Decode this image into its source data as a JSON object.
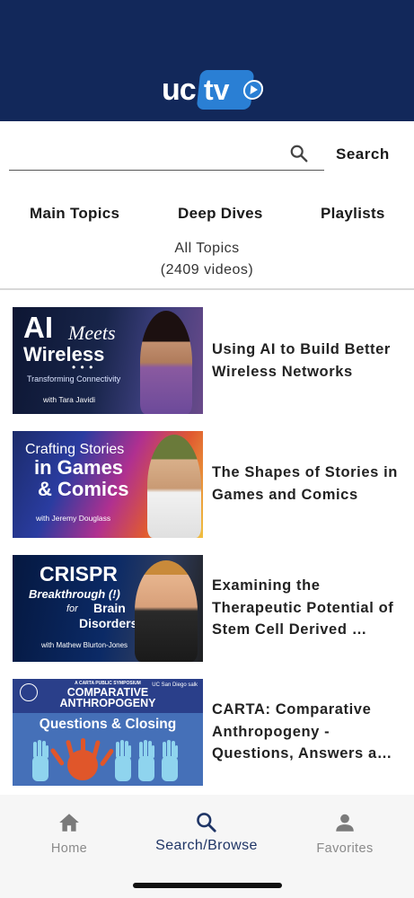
{
  "app": {
    "logo_text_left": "uc",
    "logo_text_right": "tv"
  },
  "search": {
    "placeholder": "",
    "value": "",
    "button_label": "Search",
    "icon": "search-icon"
  },
  "tabs": [
    {
      "label": "Main Topics"
    },
    {
      "label": "Deep Dives"
    },
    {
      "label": "Playlists"
    }
  ],
  "topic": {
    "title": "All Topics",
    "count": "(2409 videos)"
  },
  "videos": [
    {
      "title": "Using AI to Build Better Wireless Networks",
      "thumb": {
        "line1": "AI",
        "line2": "Meets",
        "line3": "Wireless",
        "dots": "• • •",
        "sub": "Transforming Connectivity",
        "with": "with Tara Javidi"
      }
    },
    {
      "title": "The Shapes of Stories in Games and Comics",
      "thumb": {
        "line1": "Crafting Stories",
        "line2": "in Games",
        "line3": "& Comics",
        "with": "with Jeremy Douglass"
      }
    },
    {
      "title": "Examining the Therapeutic Potential of Stem Cell Derived …",
      "thumb": {
        "line1": "CRISPR",
        "line2": "Breakthrough (!)",
        "line3": "for",
        "line4": "Brain",
        "line5": "Disorders",
        "with": "with Mathew Blurton-Jones"
      }
    },
    {
      "title": "CARTA: Comparative Anthropogeny - Questions, Answers a…",
      "thumb": {
        "line1": "A CARTA PUBLIC SYMPOSIUM",
        "line2": "COMPARATIVE",
        "line3": "ANTHROPOGENY",
        "line4": "Questions & Closing",
        "badge": "UC San Diego salk"
      }
    }
  ],
  "nav": [
    {
      "label": "Home",
      "icon": "home-icon"
    },
    {
      "label": "Search/Browse",
      "icon": "search-icon",
      "active": true
    },
    {
      "label": "Favorites",
      "icon": "person-icon"
    }
  ],
  "colors": {
    "header": "#12285a",
    "accent": "#2a7fd4",
    "active_nav": "#1f3566",
    "inactive_nav": "#8a8a8a"
  }
}
